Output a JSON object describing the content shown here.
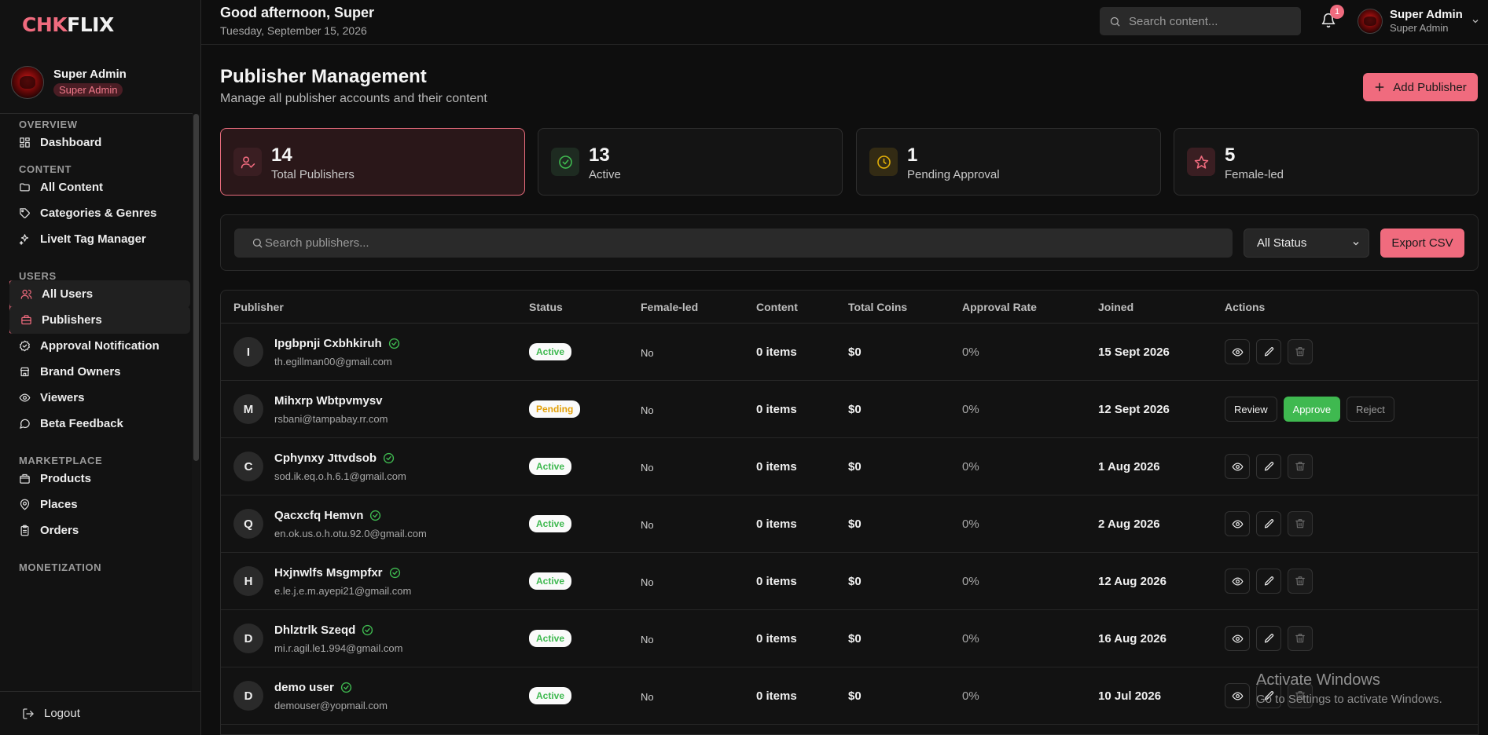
{
  "app": {
    "logo_accent": "CHK",
    "logo_rest": "FLIX",
    "accent_color": "#f06b7e"
  },
  "sidebar": {
    "user": {
      "name": "Super Admin",
      "role": "Super Admin"
    },
    "sections": [
      {
        "title": "OVERVIEW",
        "items": [
          {
            "label": "Dashboard",
            "icon": "dashboard-icon"
          }
        ]
      },
      {
        "title": "CONTENT",
        "items": [
          {
            "label": "All Content",
            "icon": "folder-icon"
          },
          {
            "label": "Categories & Genres",
            "icon": "tag-icon"
          },
          {
            "label": "LiveIt Tag Manager",
            "icon": "sparkle-icon"
          }
        ]
      },
      {
        "title": "USERS",
        "items": [
          {
            "label": "All Users",
            "icon": "users-icon"
          },
          {
            "label": "Publishers",
            "icon": "briefcase-icon"
          },
          {
            "label": "Approval Notification",
            "icon": "badge-check-icon"
          },
          {
            "label": "Brand Owners",
            "icon": "store-icon"
          },
          {
            "label": "Viewers",
            "icon": "eye-icon"
          },
          {
            "label": "Beta Feedback",
            "icon": "message-icon"
          }
        ]
      },
      {
        "title": "MARKETPLACE",
        "items": [
          {
            "label": "Products",
            "icon": "package-icon"
          },
          {
            "label": "Places",
            "icon": "map-pin-icon"
          },
          {
            "label": "Orders",
            "icon": "clipboard-icon"
          }
        ]
      },
      {
        "title": "MONETIZATION",
        "items": []
      }
    ],
    "active_items": [
      "All Users",
      "Publishers"
    ],
    "logout": "Logout"
  },
  "topbar": {
    "greeting": "Good afternoon, Super",
    "date": "Tuesday, September 15, 2026",
    "search_placeholder": "Search content...",
    "notification_count": "1",
    "user_name": "Super Admin",
    "user_role": "Super Admin"
  },
  "page": {
    "title": "Publisher Management",
    "subtitle": "Manage all publisher accounts and their content",
    "add_button": "Add Publisher"
  },
  "stats": [
    {
      "value": "14",
      "label": "Total Publishers",
      "icon": "user-check-icon",
      "color": "#f06b7e"
    },
    {
      "value": "13",
      "label": "Active",
      "icon": "check-circle-icon",
      "color": "#3fb950"
    },
    {
      "value": "1",
      "label": "Pending Approval",
      "icon": "clock-icon",
      "color": "#e3b008"
    },
    {
      "value": "5",
      "label": "Female-led",
      "icon": "star-icon",
      "color": "#f06b7e"
    }
  ],
  "filters": {
    "search_placeholder": "Search publishers...",
    "status_value": "All Status",
    "export_label": "Export CSV"
  },
  "table": {
    "columns": [
      "Publisher",
      "Status",
      "Female-led",
      "Content",
      "Total Coins",
      "Approval Rate",
      "Joined",
      "Actions"
    ],
    "rows": [
      {
        "initial": "I",
        "name": "Ipgbpnji Cxbhkiruh",
        "verified": true,
        "email": "th.egillman00@gmail.com",
        "status": "Active",
        "female_led": "No",
        "content": "0 items",
        "coins": "$0",
        "rate": "0%",
        "joined": "15 Sept 2026"
      },
      {
        "initial": "M",
        "name": "Mihxrp Wbtpvmysv",
        "verified": false,
        "email": "rsbani@tampabay.rr.com",
        "status": "Pending",
        "female_led": "No",
        "content": "0 items",
        "coins": "$0",
        "rate": "0%",
        "joined": "12 Sept 2026"
      },
      {
        "initial": "C",
        "name": "Cphynxy Jttvdsob",
        "verified": true,
        "email": "sod.ik.eq.o.h.6.1@gmail.com",
        "status": "Active",
        "female_led": "No",
        "content": "0 items",
        "coins": "$0",
        "rate": "0%",
        "joined": "1 Aug 2026"
      },
      {
        "initial": "Q",
        "name": "Qacxcfq Hemvn",
        "verified": true,
        "email": "en.ok.us.o.h.otu.92.0@gmail.com",
        "status": "Active",
        "female_led": "No",
        "content": "0 items",
        "coins": "$0",
        "rate": "0%",
        "joined": "2 Aug 2026"
      },
      {
        "initial": "H",
        "name": "Hxjnwlfs Msgmpfxr",
        "verified": true,
        "email": "e.le.j.e.m.ayepi21@gmail.com",
        "status": "Active",
        "female_led": "No",
        "content": "0 items",
        "coins": "$0",
        "rate": "0%",
        "joined": "12 Aug 2026"
      },
      {
        "initial": "D",
        "name": "Dhlztrlk Szeqd",
        "verified": true,
        "email": "mi.r.agil.le1.994@gmail.com",
        "status": "Active",
        "female_led": "No",
        "content": "0 items",
        "coins": "$0",
        "rate": "0%",
        "joined": "16 Aug 2026"
      },
      {
        "initial": "D",
        "name": "demo user",
        "verified": true,
        "email": "demouser@yopmail.com",
        "status": "Active",
        "female_led": "No",
        "content": "0 items",
        "coins": "$0",
        "rate": "0%",
        "joined": "10 Jul 2026"
      }
    ],
    "pending_actions": {
      "review": "Review",
      "approve": "Approve",
      "reject": "Reject"
    }
  },
  "watermark": {
    "title": "Activate Windows",
    "subtitle": "Go to Settings to activate Windows."
  }
}
